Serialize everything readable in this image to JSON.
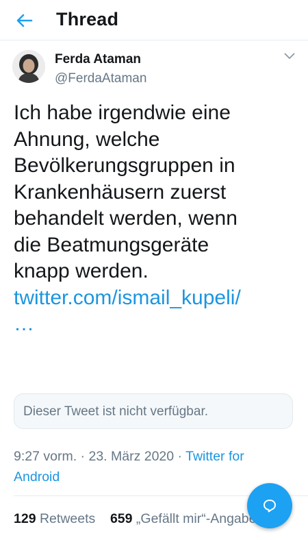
{
  "header": {
    "title": "Thread"
  },
  "author": {
    "name": "Ferda Ataman",
    "handle": "@FerdaAtaman"
  },
  "tweet": {
    "lines": [
      "Ich habe irgendwie eine",
      "Ahnung, welche",
      "Bevölkerungsgruppen in",
      "Krankenhäusern zuerst",
      "behandelt werden, wenn",
      "die Beatmungsgeräte",
      "knapp werden."
    ],
    "link_line1": "twitter.com/ismail_kupeli/",
    "link_line2": "…"
  },
  "quoted": {
    "text": "Dieser Tweet ist nicht verfügbar."
  },
  "meta": {
    "time": "9:27 vorm.",
    "separator": " · ",
    "date": "23. März 2020",
    "source_line1": "Twitter for",
    "source_line2": "Android"
  },
  "stats": {
    "retweets_count": "129",
    "retweets_label": "Retweets",
    "likes_count": "659",
    "likes_label": "„Gefällt mir“-Angaben"
  },
  "colors": {
    "accent": "#1da1f2",
    "link": "#1b95e0",
    "secondary_text": "#657786"
  },
  "icons": {
    "back": "arrow-left-icon",
    "menu": "chevron-down-icon",
    "compose": "reply-bubble-icon"
  }
}
